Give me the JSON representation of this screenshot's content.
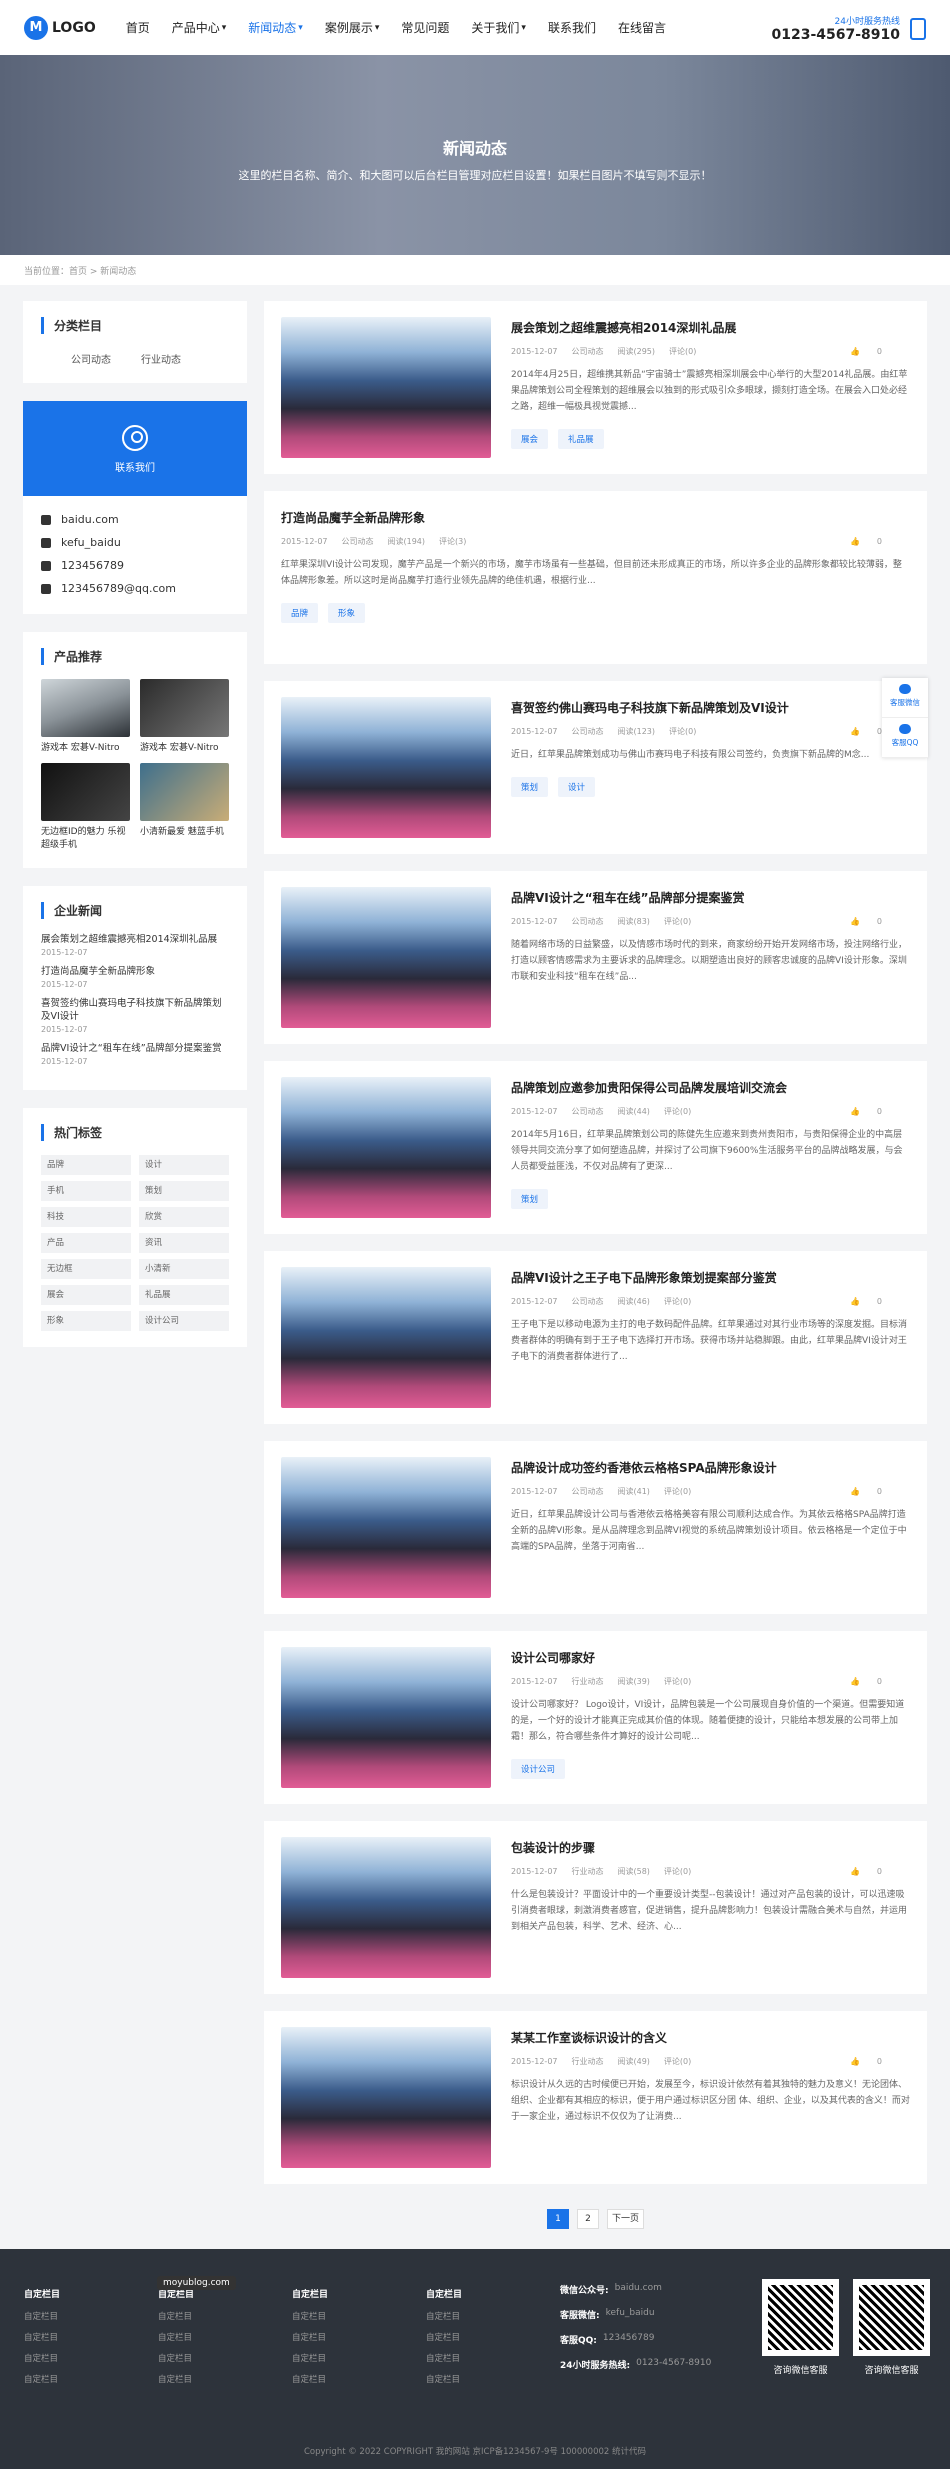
{
  "header": {
    "logo_mark": "M",
    "logo_text": "LOGO",
    "nav": [
      {
        "label": "首页",
        "dropdown": false
      },
      {
        "label": "产品中心",
        "dropdown": true
      },
      {
        "label": "新闻动态",
        "dropdown": true
      },
      {
        "label": "案例展示",
        "dropdown": true
      },
      {
        "label": "常见问题",
        "dropdown": false
      },
      {
        "label": "关于我们",
        "dropdown": true
      },
      {
        "label": "联系我们",
        "dropdown": false
      },
      {
        "label": "在线留言",
        "dropdown": false
      }
    ],
    "hotline_label": "24小时服务热线",
    "hotline_number": "0123-4567-8910"
  },
  "banner": {
    "title": "新闻动态",
    "subtitle": "这里的栏目名称、简介、和大图可以后台栏目管理对应栏目设置！如果栏目图片不填写则不显示！"
  },
  "breadcrumb": "当前位置：首页 > 新闻动态",
  "sidebar": {
    "category_title": "分类栏目",
    "categories": [
      "公司动态",
      "行业动态"
    ],
    "contact_label": "联系我们",
    "contacts": [
      "baidu.com",
      "kefu_baidu",
      "123456789",
      "123456789@qq.com"
    ],
    "products_title": "产品推荐",
    "products": [
      "游戏本 宏碁V-Nitro",
      "游戏本 宏碁V-Nitro",
      "无边框ID的魅力 乐视超级手机",
      "小清新最爱 魅蓝手机"
    ],
    "news_title": "企业新闻",
    "news": [
      {
        "title": "展会策划之超维震撼亮相2014深圳礼品展",
        "date": "2015-12-07"
      },
      {
        "title": "打造尚品魔芋全新品牌形象",
        "date": "2015-12-07"
      },
      {
        "title": "喜贺签约佛山赛玛电子科技旗下新品牌策划及VI设计",
        "date": "2015-12-07"
      },
      {
        "title": "品牌VI设计之“租车在线”品牌部分提案鉴赏",
        "date": "2015-12-07"
      }
    ],
    "tags_title": "热门标签",
    "tags": [
      "品牌",
      "设计",
      "手机",
      "策划",
      "科技",
      "欣赏",
      "产品",
      "资讯",
      "无边框",
      "小清新",
      "展会",
      "礼品展",
      "形象",
      "设计公司"
    ]
  },
  "articles": [
    {
      "title": "展会策划之超维震撼亮相2014深圳礼品展",
      "date": "2015-12-07",
      "cat": "公司动态",
      "views": "阅读(295)",
      "comments": "评论(0)",
      "likes": "0",
      "summary": "2014年4月25日，超维携其新品“宇宙骑士”震撼亮相深圳展会中心举行的大型2014礼品展。由红苹果品牌策划公司全程策划的超维展会以独到的形式吸引众多眼球，撷刻打造全场。在展会入口处必经之路，超维一幅极具视觉震撼...",
      "tags": [
        "展会",
        "礼品展"
      ],
      "image": true
    },
    {
      "title": "打造尚品魔芋全新品牌形象",
      "date": "2015-12-07",
      "cat": "公司动态",
      "views": "阅读(194)",
      "comments": "评论(3)",
      "likes": "0",
      "summary": "红苹果深圳VI设计公司发现，魔芋产品是一个新兴的市场，魔芋市场虽有一些基础，但目前还未形成真正的市场，所以许多企业的品牌形象都较比较薄弱，整体品牌形象差。所以这时是尚品魔芋打造行业领先品牌的绝佳机遇，根据行业...",
      "tags": [
        "品牌",
        "形象"
      ],
      "image": false
    },
    {
      "title": "喜贺签约佛山赛玛电子科技旗下新品牌策划及VI设计",
      "date": "2015-12-07",
      "cat": "公司动态",
      "views": "阅读(123)",
      "comments": "评论(0)",
      "likes": "0",
      "summary": "近日，红苹果品牌策划成功与佛山市赛玛电子科技有限公司签约，负责旗下新品牌的M念...",
      "tags": [
        "策划",
        "设计"
      ],
      "image": true
    },
    {
      "title": "品牌VI设计之“租车在线”品牌部分提案鉴赏",
      "date": "2015-12-07",
      "cat": "公司动态",
      "views": "阅读(83)",
      "comments": "评论(0)",
      "likes": "0",
      "summary": "随着网络市场的日益繁盛，以及情感市场时代的到来，商家纷纷开始开发网络市场，投注网络行业，打造以顾客情感需求为主要诉求的品牌理念。以期塑造出良好的顾客忠诚度的品牌VI设计形象。深圳市联和安业科技“租车在线”品...",
      "tags": [],
      "image": true
    },
    {
      "title": "品牌策划应邀参加贵阳保得公司品牌发展培训交流会",
      "date": "2015-12-07",
      "cat": "公司动态",
      "views": "阅读(44)",
      "comments": "评论(0)",
      "likes": "0",
      "summary": "2014年5月16日，红苹果品牌策划公司的陈健先生应邀来到贵州贵阳市，与贵阳保得企业的中高层领导共同交流分享了如何塑造品牌，并探讨了公司旗下9600%生活服务平台的品牌战略发展，与会人员都受益匪浅，不仅对品牌有了更深...",
      "tags": [
        "策划"
      ],
      "image": true
    },
    {
      "title": "品牌VI设计之王子电下品牌形象策划提案部分鉴赏",
      "date": "2015-12-07",
      "cat": "公司动态",
      "views": "阅读(46)",
      "comments": "评论(0)",
      "likes": "0",
      "summary": "王子电下是以移动电源为主打的电子数码配件品牌。红苹果通过对其行业市场等的深度发掘。目标消费者群体的明确有到于王子电下选择打开市场。获得市场并站稳脚跟。由此，红苹果品牌VI设计对王子电下的消费者群体进行了...",
      "tags": [],
      "image": true
    },
    {
      "title": "品牌设计成功签约香港依云格格SPA品牌形象设计",
      "date": "2015-12-07",
      "cat": "公司动态",
      "views": "阅读(41)",
      "comments": "评论(0)",
      "likes": "0",
      "summary": "近日，红苹果品牌设计公司与香港依云格格美容有限公司顺利达成合作。为其依云格格SPA品牌打造全新的品牌VI形象。是从品牌理念到品牌VI视觉的系统品牌策划设计项目。依云格格是一个定位于中高端的SPA品牌，坐落于河南省...",
      "tags": [],
      "image": true
    },
    {
      "title": "设计公司哪家好",
      "date": "2015-12-07",
      "cat": "行业动态",
      "views": "阅读(39)",
      "comments": "评论(0)",
      "likes": "0",
      "summary": "设计公司哪家好？ Logo设计，VI设计，品牌包装是一个公司展现自身价值的一个渠道。但需要知道的是，一个好的设计才能真正完成其价值的体现。随着便捷的设计，只能给本想发展的公司带上加霜！那么，符合哪些条件才算好的设计公司呢...",
      "tags": [
        "设计公司"
      ],
      "image": true
    },
    {
      "title": "包装设计的步骤",
      "date": "2015-12-07",
      "cat": "行业动态",
      "views": "阅读(58)",
      "comments": "评论(0)",
      "likes": "0",
      "summary": "什么是包装设计？平面设计中的一个重要设计类型--包装设计！通过对产品包装的设计，可以迅速吸引消费者眼球，刺激消费者感官，促进销售，提升品牌影响力！包装设计需融合美术与自然，并运用到相关产品包装，科学、艺术、经济、心...",
      "tags": [],
      "image": true
    },
    {
      "title": "某某工作室谈标识设计的含义",
      "date": "2015-12-07",
      "cat": "行业动态",
      "views": "阅读(49)",
      "comments": "评论(0)",
      "likes": "0",
      "summary": "标识设计从久远的古时候便已开始，发展至今，标识设计依然有着其独特的魅力及意义！无论团体、组织、企业都有其相应的标识，便于用户通过标识区分团 体、组织、企业，以及其代表的含义！而对于一家企业，通过标识不仅仅为了让消费...",
      "tags": [],
      "image": true
    }
  ],
  "pagination": [
    "1",
    "2",
    "下一页"
  ],
  "float_bar": [
    "客服微信",
    "客服QQ"
  ],
  "footer": {
    "columns": [
      {
        "title": "自定栏目",
        "links": [
          "自定栏目",
          "自定栏目",
          "自定栏目",
          "自定栏目"
        ]
      },
      {
        "title": "自定栏目",
        "links": [
          "自定栏目",
          "自定栏目",
          "自定栏目",
          "自定栏目"
        ]
      },
      {
        "title": "自定栏目",
        "links": [
          "自定栏目",
          "自定栏目",
          "自定栏目",
          "自定栏目"
        ]
      },
      {
        "title": "自定栏目",
        "links": [
          "自定栏目",
          "自定栏目",
          "自定栏目",
          "自定栏目"
        ]
      }
    ],
    "info": [
      {
        "key": "微信公众号:",
        "val": "baidu.com"
      },
      {
        "key": "客服微信:",
        "val": "kefu_baidu"
      },
      {
        "key": "客服QQ:",
        "val": "123456789"
      },
      {
        "key": "24小时服务热线:",
        "val": "0123-4567-8910"
      }
    ],
    "qr": [
      "咨询微信客服",
      "咨询微信客服"
    ],
    "copyright": "Copyright © 2022 COPYRIGHT 我的网站 京ICP备1234567-9号 100000002 统计代码"
  },
  "watermark": "moyublog.com"
}
